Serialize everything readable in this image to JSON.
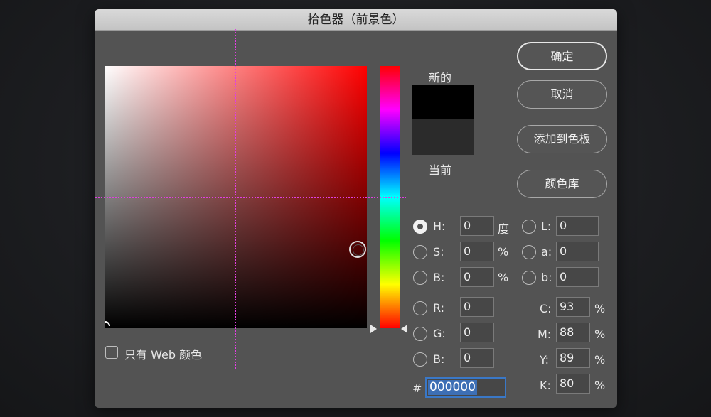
{
  "dialog": {
    "title": "拾色器（前景色）"
  },
  "swatches": {
    "new_label": "新的",
    "current_label": "当前",
    "new_color": "#000000",
    "current_color": "#2b2b2b"
  },
  "buttons": {
    "ok": "确定",
    "cancel": "取消",
    "add_to_swatches": "添加到色板",
    "color_libraries": "颜色库"
  },
  "web_only": {
    "label": "只有 Web 颜色",
    "checked": false
  },
  "hsb": {
    "h": {
      "label": "H:",
      "value": "0",
      "unit": "度",
      "selected": true
    },
    "s": {
      "label": "S:",
      "value": "0",
      "unit": "%"
    },
    "b": {
      "label": "B:",
      "value": "0",
      "unit": "%"
    }
  },
  "rgb": {
    "r": {
      "label": "R:",
      "value": "0"
    },
    "g": {
      "label": "G:",
      "value": "0"
    },
    "b": {
      "label": "B:",
      "value": "0"
    }
  },
  "lab": {
    "l": {
      "label": "L:",
      "value": "0"
    },
    "a": {
      "label": "a:",
      "value": "0"
    },
    "b": {
      "label": "b:",
      "value": "0"
    }
  },
  "cmyk": {
    "c": {
      "label": "C:",
      "value": "93",
      "unit": "%"
    },
    "m": {
      "label": "M:",
      "value": "88",
      "unit": "%"
    },
    "y": {
      "label": "Y:",
      "value": "89",
      "unit": "%"
    },
    "k": {
      "label": "K:",
      "value": "80",
      "unit": "%"
    }
  },
  "hex": {
    "label": "#",
    "value": "000000"
  },
  "colors": {
    "accent": "#3a78c7",
    "guide": "#e040e0",
    "dialog_bg": "#535353"
  }
}
